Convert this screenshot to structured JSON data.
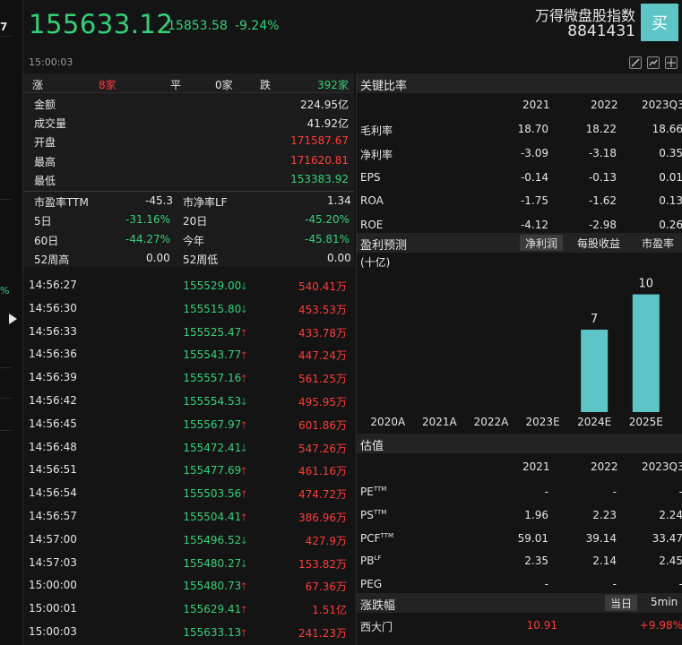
{
  "header": {
    "price": "155633.12",
    "change": "-15853.58",
    "change_pct": "-9.24%",
    "name": "万得微盘股指数",
    "code": "8841431",
    "buy_label": "买",
    "time": "15:00:03"
  },
  "left_strip": {
    "edge_num": "7",
    "edge_pct": "%"
  },
  "updown": {
    "up_label": "涨",
    "up_count": "8家",
    "flat_label": "平",
    "flat_count": "0家",
    "down_label": "跌",
    "down_count": "392家"
  },
  "stats": [
    {
      "label": "金额",
      "value": "224.95亿",
      "color": "white"
    },
    {
      "label": "成交量",
      "value": "41.92亿",
      "color": "white"
    },
    {
      "label": "开盘",
      "value": "171587.67",
      "color": "red"
    },
    {
      "label": "最高",
      "value": "171620.81",
      "color": "red"
    },
    {
      "label": "最低",
      "value": "153383.92",
      "color": "green"
    }
  ],
  "grid": {
    "pe_label": "市盈率TTM",
    "pe_value": "-45.3",
    "pb_label": "市净率LF",
    "pb_value": "1.34",
    "d5_label": "5日",
    "d5_value": "-31.16%",
    "d20_label": "20日",
    "d20_value": "-45.20%",
    "d60_label": "60日",
    "d60_value": "-44.27%",
    "ytd_label": "今年",
    "ytd_value": "-45.81%",
    "w52h_label": "52周高",
    "w52h_value": "0.00",
    "w52l_label": "52周低",
    "w52l_value": "0.00"
  },
  "ticks": [
    {
      "time": "14:56:27",
      "price": "155529.00",
      "dir": "down",
      "vol": "540.41万"
    },
    {
      "time": "14:56:30",
      "price": "155515.80",
      "dir": "down",
      "vol": "453.53万"
    },
    {
      "time": "14:56:33",
      "price": "155525.47",
      "dir": "up",
      "vol": "433.78万"
    },
    {
      "time": "14:56:36",
      "price": "155543.77",
      "dir": "up",
      "vol": "447.24万"
    },
    {
      "time": "14:56:39",
      "price": "155557.16",
      "dir": "up",
      "vol": "561.25万"
    },
    {
      "time": "14:56:42",
      "price": "155554.53",
      "dir": "down",
      "vol": "495.95万"
    },
    {
      "time": "14:56:45",
      "price": "155567.97",
      "dir": "up",
      "vol": "601.86万"
    },
    {
      "time": "14:56:48",
      "price": "155472.41",
      "dir": "down",
      "vol": "547.26万"
    },
    {
      "time": "14:56:51",
      "price": "155477.69",
      "dir": "up",
      "vol": "461.16万"
    },
    {
      "time": "14:56:54",
      "price": "155503.56",
      "dir": "up",
      "vol": "474.72万"
    },
    {
      "time": "14:56:57",
      "price": "155504.41",
      "dir": "up",
      "vol": "386.96万"
    },
    {
      "time": "14:57:00",
      "price": "155496.52",
      "dir": "down",
      "vol": "427.9万"
    },
    {
      "time": "14:57:03",
      "price": "155480.27",
      "dir": "down",
      "vol": "153.82万"
    },
    {
      "time": "15:00:00",
      "price": "155480.73",
      "dir": "up",
      "vol": "67.36万"
    },
    {
      "time": "15:00:01",
      "price": "155629.41",
      "dir": "up",
      "vol": "1.51亿"
    },
    {
      "time": "15:00:03",
      "price": "155633.13",
      "dir": "up",
      "vol": "241.23万"
    }
  ],
  "colors": {
    "up": "#ff3b3b",
    "down": "#33d17a",
    "accent": "#5ec5c6"
  },
  "key_ratios": {
    "title": "关键比率",
    "years": [
      "2021",
      "2022",
      "2023Q3"
    ],
    "rows": [
      {
        "label": "毛利率",
        "values": [
          "18.70",
          "18.22",
          "18.66"
        ]
      },
      {
        "label": "净利率",
        "values": [
          "-3.09",
          "-3.18",
          "0.35"
        ]
      },
      {
        "label": "EPS",
        "values": [
          "-0.14",
          "-0.13",
          "0.01"
        ]
      },
      {
        "label": "ROA",
        "values": [
          "-1.75",
          "-1.62",
          "0.13"
        ]
      },
      {
        "label": "ROE",
        "values": [
          "-4.12",
          "-2.98",
          "0.26"
        ]
      }
    ]
  },
  "forecast": {
    "title": "盈利预测",
    "tabs": [
      "净利润",
      "每股收益",
      "市盈率"
    ],
    "unit": "(十亿)"
  },
  "chart_data": {
    "type": "bar",
    "categories": [
      "2020A",
      "2021A",
      "2022A",
      "2023E",
      "2024E",
      "2025E"
    ],
    "values": [
      null,
      null,
      null,
      null,
      7,
      10
    ],
    "ylim": [
      0,
      10.5
    ],
    "color": "#5ec5c6",
    "grid": false
  },
  "valuation": {
    "title": "估值",
    "years": [
      "2021",
      "2022",
      "2023Q3"
    ],
    "rows": [
      {
        "label": "PE",
        "sup": "TTM",
        "values": [
          "-",
          "-",
          "-"
        ]
      },
      {
        "label": "PS",
        "sup": "TTM",
        "values": [
          "1.96",
          "2.23",
          "2.24"
        ]
      },
      {
        "label": "PCF",
        "sup": "TTM",
        "values": [
          "59.01",
          "39.14",
          "33.47"
        ]
      },
      {
        "label": "PB",
        "sup": "LF",
        "values": [
          "2.35",
          "2.14",
          "2.45"
        ]
      },
      {
        "label": "PEG",
        "sup": "",
        "values": [
          "-",
          "-",
          "-"
        ]
      }
    ]
  },
  "movers": {
    "title": "涨跌幅",
    "tabs": [
      "当日",
      "5min"
    ],
    "rows": [
      {
        "name": "西大门",
        "price": "10.91",
        "pct": "+9.98%"
      }
    ]
  }
}
